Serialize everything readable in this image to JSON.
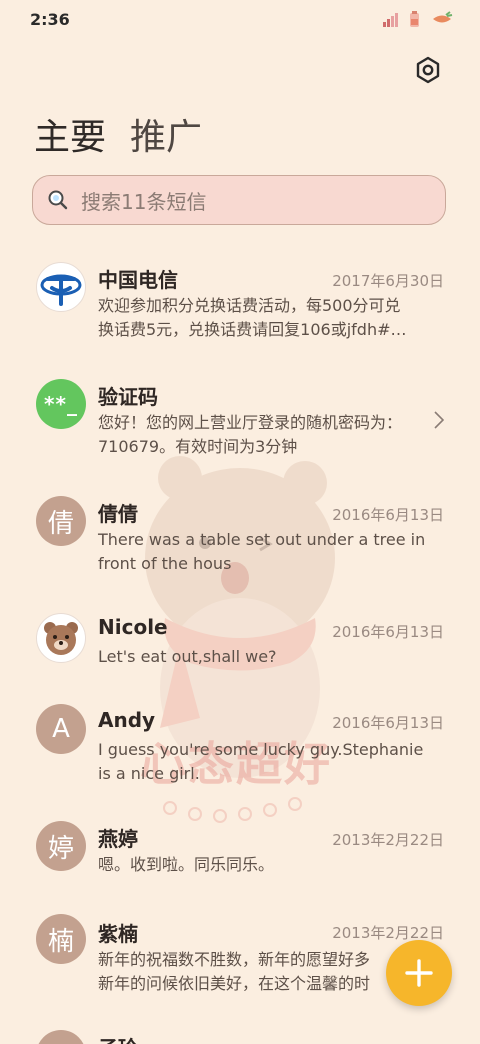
{
  "status": {
    "time": "2:36"
  },
  "tabs": [
    {
      "label": "主要",
      "active": true
    },
    {
      "label": "推广",
      "active": false
    }
  ],
  "search": {
    "placeholder": "搜索11条短信"
  },
  "messages": [
    {
      "avatar": "",
      "avatar_type": "telecom-logo",
      "name": "中国电信",
      "date": "2017年6月30日",
      "line1": "欢迎参加积分兑换话费活动，每500分可兑",
      "line2": "换话费5元，兑换话费请回复106或jfdh#…"
    },
    {
      "avatar": "**_",
      "avatar_type": "green",
      "name": "验证码",
      "date": "",
      "line1": "您好！您的网上营业厅登录的随机密码为：",
      "line2": "710679。有效时间为3分钟"
    },
    {
      "avatar": "倩",
      "avatar_type": "brown",
      "name": "倩倩",
      "date": "2016年6月13日",
      "line1": "There was a table set out under a tree in",
      "line2": "front of the hous"
    },
    {
      "avatar": "",
      "avatar_type": "bear",
      "name": "Nicole",
      "date": "2016年6月13日",
      "line1": "Let's eat out,shall we?",
      "line2": ""
    },
    {
      "avatar": "A",
      "avatar_type": "brown",
      "name": "Andy",
      "date": "2016年6月13日",
      "line1": "I guess you're some lucky guy.Stephanie",
      "line2": "is a nice girl."
    },
    {
      "avatar": "婷",
      "avatar_type": "brown",
      "name": "燕婷",
      "date": "2013年2月22日",
      "line1": "嗯。收到啦。同乐同乐。",
      "line2": ""
    },
    {
      "avatar": "楠",
      "avatar_type": "brown",
      "name": "紫楠",
      "date": "2013年2月22日",
      "line1": "新年的祝福数不胜数，新年的愿望好多",
      "line2": "新年的问候依旧美好，在这个温馨的时"
    },
    {
      "avatar": "",
      "avatar_type": "brown",
      "name": "子玲",
      "date": "",
      "line1": "",
      "line2": ""
    }
  ],
  "watermark_text": "心态超好",
  "colors": {
    "background": "#fbeee0",
    "search_bg": "#f8d9d1",
    "avatar_brown": "#c3a18f",
    "avatar_green": "#63c65e",
    "fab": "#f6b62b"
  },
  "icons": {
    "settings": "gear-icon",
    "search": "search-icon",
    "compose": "plus-icon"
  }
}
